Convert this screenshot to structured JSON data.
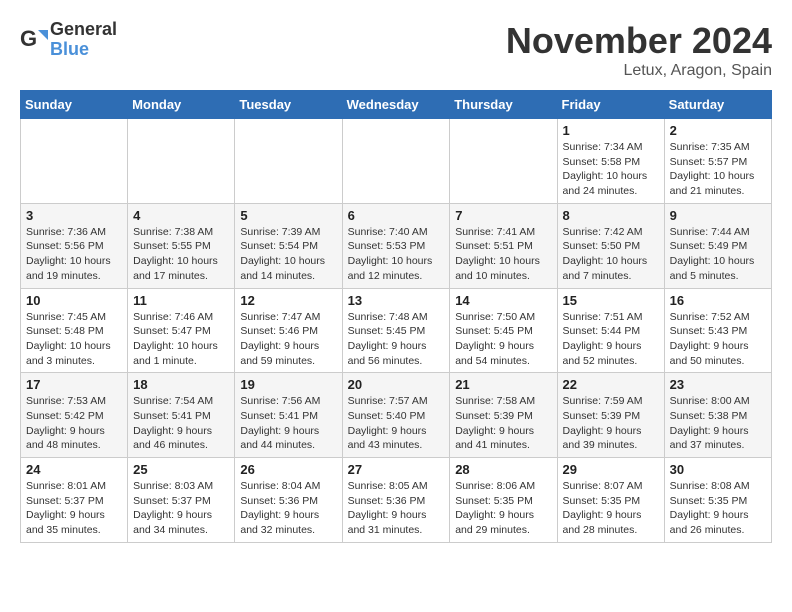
{
  "logo": {
    "line1": "General",
    "line2": "Blue"
  },
  "title": "November 2024",
  "location": "Letux, Aragon, Spain",
  "weekdays": [
    "Sunday",
    "Monday",
    "Tuesday",
    "Wednesday",
    "Thursday",
    "Friday",
    "Saturday"
  ],
  "weeks": [
    [
      {
        "day": "",
        "info": ""
      },
      {
        "day": "",
        "info": ""
      },
      {
        "day": "",
        "info": ""
      },
      {
        "day": "",
        "info": ""
      },
      {
        "day": "",
        "info": ""
      },
      {
        "day": "1",
        "info": "Sunrise: 7:34 AM\nSunset: 5:58 PM\nDaylight: 10 hours and 24 minutes."
      },
      {
        "day": "2",
        "info": "Sunrise: 7:35 AM\nSunset: 5:57 PM\nDaylight: 10 hours and 21 minutes."
      }
    ],
    [
      {
        "day": "3",
        "info": "Sunrise: 7:36 AM\nSunset: 5:56 PM\nDaylight: 10 hours and 19 minutes."
      },
      {
        "day": "4",
        "info": "Sunrise: 7:38 AM\nSunset: 5:55 PM\nDaylight: 10 hours and 17 minutes."
      },
      {
        "day": "5",
        "info": "Sunrise: 7:39 AM\nSunset: 5:54 PM\nDaylight: 10 hours and 14 minutes."
      },
      {
        "day": "6",
        "info": "Sunrise: 7:40 AM\nSunset: 5:53 PM\nDaylight: 10 hours and 12 minutes."
      },
      {
        "day": "7",
        "info": "Sunrise: 7:41 AM\nSunset: 5:51 PM\nDaylight: 10 hours and 10 minutes."
      },
      {
        "day": "8",
        "info": "Sunrise: 7:42 AM\nSunset: 5:50 PM\nDaylight: 10 hours and 7 minutes."
      },
      {
        "day": "9",
        "info": "Sunrise: 7:44 AM\nSunset: 5:49 PM\nDaylight: 10 hours and 5 minutes."
      }
    ],
    [
      {
        "day": "10",
        "info": "Sunrise: 7:45 AM\nSunset: 5:48 PM\nDaylight: 10 hours and 3 minutes."
      },
      {
        "day": "11",
        "info": "Sunrise: 7:46 AM\nSunset: 5:47 PM\nDaylight: 10 hours and 1 minute."
      },
      {
        "day": "12",
        "info": "Sunrise: 7:47 AM\nSunset: 5:46 PM\nDaylight: 9 hours and 59 minutes."
      },
      {
        "day": "13",
        "info": "Sunrise: 7:48 AM\nSunset: 5:45 PM\nDaylight: 9 hours and 56 minutes."
      },
      {
        "day": "14",
        "info": "Sunrise: 7:50 AM\nSunset: 5:45 PM\nDaylight: 9 hours and 54 minutes."
      },
      {
        "day": "15",
        "info": "Sunrise: 7:51 AM\nSunset: 5:44 PM\nDaylight: 9 hours and 52 minutes."
      },
      {
        "day": "16",
        "info": "Sunrise: 7:52 AM\nSunset: 5:43 PM\nDaylight: 9 hours and 50 minutes."
      }
    ],
    [
      {
        "day": "17",
        "info": "Sunrise: 7:53 AM\nSunset: 5:42 PM\nDaylight: 9 hours and 48 minutes."
      },
      {
        "day": "18",
        "info": "Sunrise: 7:54 AM\nSunset: 5:41 PM\nDaylight: 9 hours and 46 minutes."
      },
      {
        "day": "19",
        "info": "Sunrise: 7:56 AM\nSunset: 5:41 PM\nDaylight: 9 hours and 44 minutes."
      },
      {
        "day": "20",
        "info": "Sunrise: 7:57 AM\nSunset: 5:40 PM\nDaylight: 9 hours and 43 minutes."
      },
      {
        "day": "21",
        "info": "Sunrise: 7:58 AM\nSunset: 5:39 PM\nDaylight: 9 hours and 41 minutes."
      },
      {
        "day": "22",
        "info": "Sunrise: 7:59 AM\nSunset: 5:39 PM\nDaylight: 9 hours and 39 minutes."
      },
      {
        "day": "23",
        "info": "Sunrise: 8:00 AM\nSunset: 5:38 PM\nDaylight: 9 hours and 37 minutes."
      }
    ],
    [
      {
        "day": "24",
        "info": "Sunrise: 8:01 AM\nSunset: 5:37 PM\nDaylight: 9 hours and 35 minutes."
      },
      {
        "day": "25",
        "info": "Sunrise: 8:03 AM\nSunset: 5:37 PM\nDaylight: 9 hours and 34 minutes."
      },
      {
        "day": "26",
        "info": "Sunrise: 8:04 AM\nSunset: 5:36 PM\nDaylight: 9 hours and 32 minutes."
      },
      {
        "day": "27",
        "info": "Sunrise: 8:05 AM\nSunset: 5:36 PM\nDaylight: 9 hours and 31 minutes."
      },
      {
        "day": "28",
        "info": "Sunrise: 8:06 AM\nSunset: 5:35 PM\nDaylight: 9 hours and 29 minutes."
      },
      {
        "day": "29",
        "info": "Sunrise: 8:07 AM\nSunset: 5:35 PM\nDaylight: 9 hours and 28 minutes."
      },
      {
        "day": "30",
        "info": "Sunrise: 8:08 AM\nSunset: 5:35 PM\nDaylight: 9 hours and 26 minutes."
      }
    ]
  ]
}
